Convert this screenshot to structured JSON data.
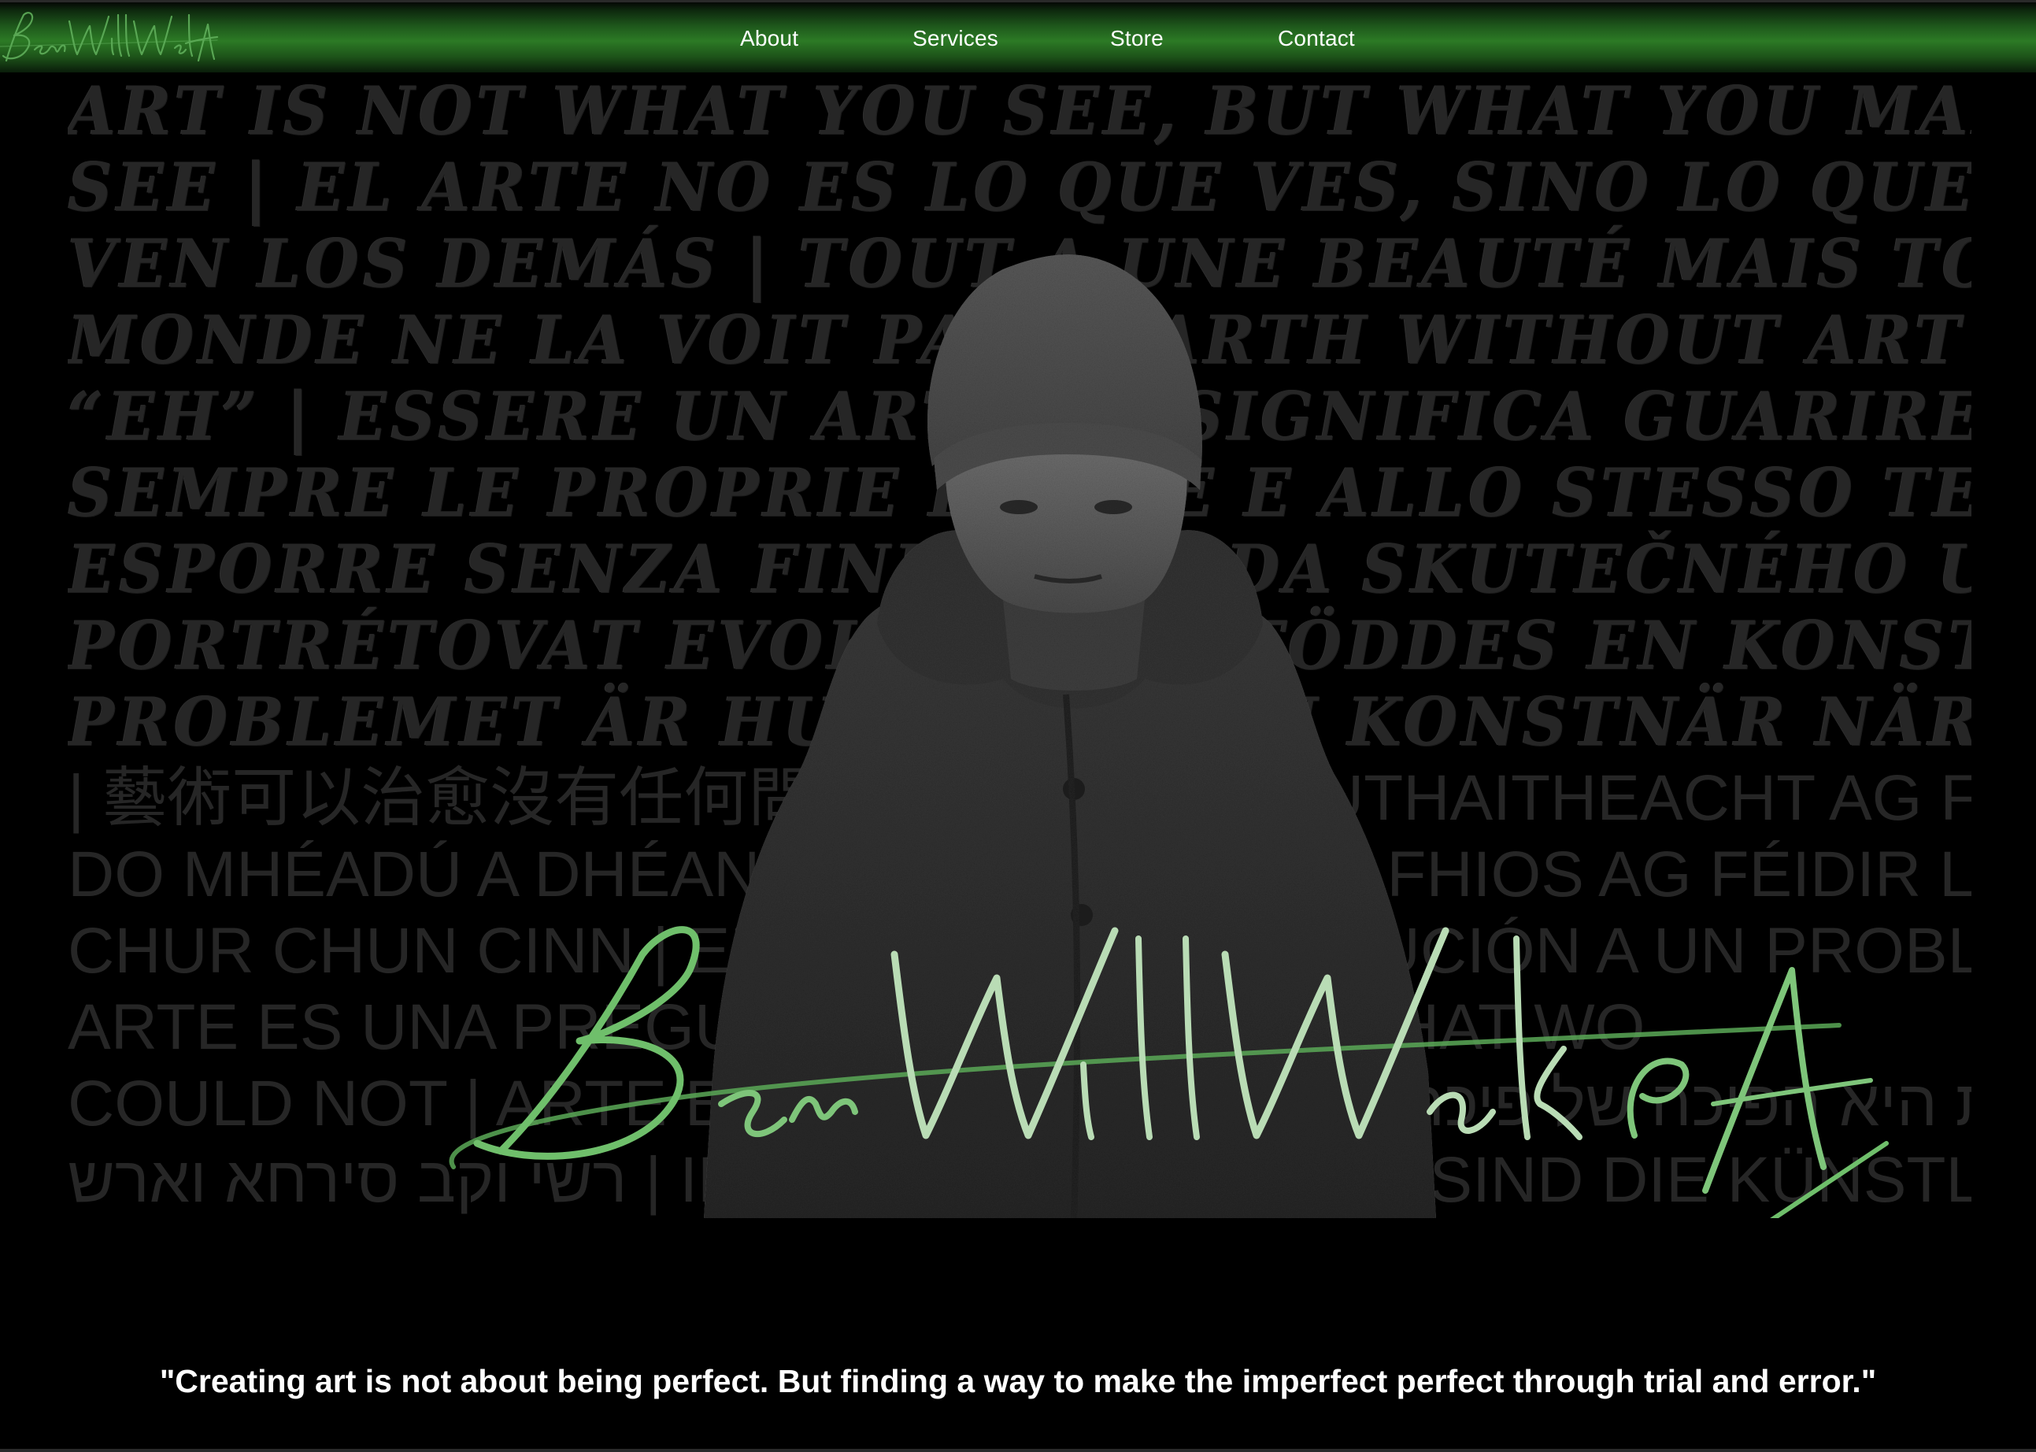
{
  "brand": {
    "logo_text": "BenWillWalk Art",
    "logo_color": "#5fae5a",
    "accent_green": "#2c7a25"
  },
  "nav": {
    "items": [
      {
        "label": "About"
      },
      {
        "label": "Services"
      },
      {
        "label": "Store"
      },
      {
        "label": "Contact"
      }
    ]
  },
  "hero": {
    "quote_wall_lines": [
      "ART IS NOT WHAT YOU SEE, BUT WHAT YOU MAKE OTH",
      "SEE | EL ARTE NO ES LO QUE VES, SINO LO QUE HACES Q",
      "VEN LOS DEMÁS | TOUT A UNE BEAUTÉ MAIS TOUT",
      "MONDE NE LA VOIT PAS | EARTH WITHOUT ART IS J",
      "“EH” | ESSERE UN ARTISTA SIGNIFICA GUARIRE T",
      "SEMPRE LE PROPRIE FERITE E ALLO STESSO TEM",
      "ESPORRE SENZA FINE | ZÁSADA SKUTEČNÉHO UMĚNÍ N",
      "PORTRÉTOVAT EVOKE | ALLA FÖDDES EN KONSTN",
      "PROBLEMET ÄR HUR AT BLI EN KONSTNÄR NÄR VI VÄ",
      "| 藝術可以治愈沒有任何問題的疾病 | TÁ CRUTHAITHEACHT AG FÉIDI",
      "DO MHÉADÚ A DHÉANAMH. Tá EALAÍN AG FHIOS AG FÉIDIR LE hAC",
      "CHUR CHUN CINN | EL DISEÑO ES LA SOLUCIÓN A UN PROBLEMA",
      "ARTE ES UNA PREGUNTA | ART SPEAKS WHAT WO",
      "COULD NOT | ARTE E BELLEZZA | האמנות היא הפיכה של פיכתהל תלוביה",
      "רשי וקב סירחא וארש | IN JEDEM KUNSTWERK SIND DIE KÜNSTLER PRÄSEN"
    ],
    "signature_text": "BenWillWalk Art",
    "signature_color": "#7ec57a"
  },
  "tagline": {
    "text": "\"Creating art is not about being perfect. But finding a way to make the imperfect perfect through trial and error.\""
  }
}
